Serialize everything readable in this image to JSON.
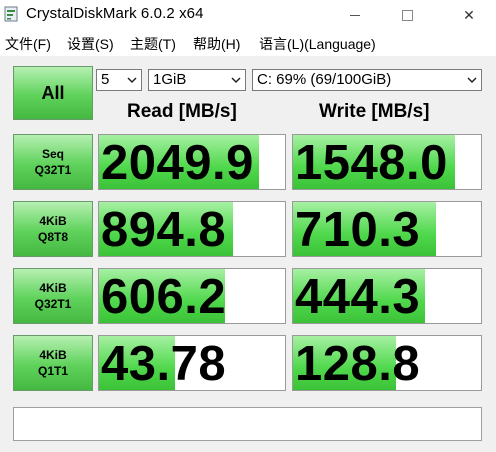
{
  "app": {
    "title": "CrystalDiskMark 6.0.2 x64",
    "icon": "crystaldiskmark-icon"
  },
  "window_controls": {
    "minimize": "minimize",
    "maximize": "maximize",
    "close": "✕"
  },
  "menu": [
    {
      "label": "文件(F)"
    },
    {
      "label": "设置(S)"
    },
    {
      "label": "主题(T)"
    },
    {
      "label": "帮助(H)"
    },
    {
      "label": "语言(L)(Language)"
    }
  ],
  "controls": {
    "all_label": "All",
    "test_count": "5",
    "test_size": "1GiB",
    "drive": "C: 69% (69/100GiB)"
  },
  "headers": {
    "read": "Read [MB/s]",
    "write": "Write [MB/s]"
  },
  "tests": [
    {
      "line1": "Seq",
      "line2": "Q32T1",
      "read": "2049.9",
      "write": "1548.0",
      "read_fill": 0.86,
      "write_fill": 0.86
    },
    {
      "line1": "4KiB",
      "line2": "Q8T8",
      "read": "894.8",
      "write": "710.3",
      "read_fill": 0.72,
      "write_fill": 0.76
    },
    {
      "line1": "4KiB",
      "line2": "Q32T1",
      "read": "606.2",
      "write": "444.3",
      "read_fill": 0.68,
      "write_fill": 0.7
    },
    {
      "line1": "4KiB",
      "line2": "Q1T1",
      "read": "43.78",
      "write": "128.8",
      "read_fill": 0.41,
      "write_fill": 0.55
    }
  ],
  "comment": "",
  "colors": {
    "accent_green": "#4fd84b",
    "button_green": "#5ed25a"
  }
}
